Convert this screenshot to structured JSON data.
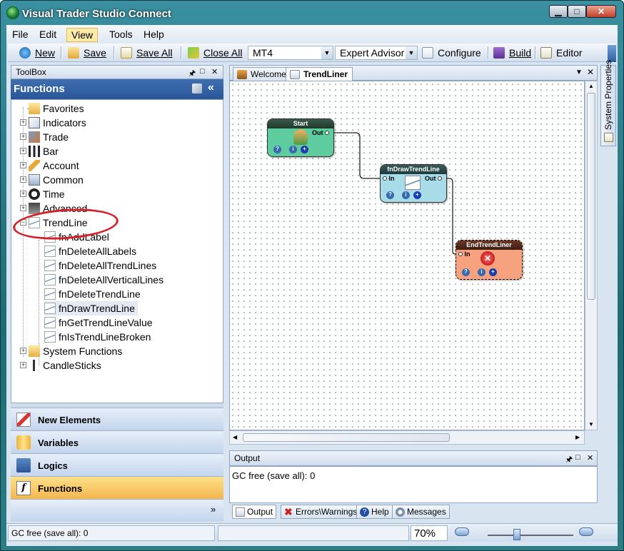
{
  "window": {
    "title": "Visual Trader Studio Connect"
  },
  "menu": [
    "File",
    "Edit",
    "View",
    "Tools",
    "Help"
  ],
  "toolbar": {
    "new_label": "New",
    "save_label": "Save",
    "save_all_label": "Save All",
    "close_all_label": "Close All",
    "platform_select": "MT4",
    "type_select": "Expert Advisor",
    "configure_label": "Configure",
    "build_label": "Build",
    "editor_label": "Editor"
  },
  "toolbox": {
    "header": "ToolBox",
    "section_title": "Functions",
    "tree": [
      {
        "label": "Favorites",
        "icon": "star-folder-icon"
      },
      {
        "label": "Indicators",
        "icon": "chart-icon"
      },
      {
        "label": "Trade",
        "icon": "trade-icon"
      },
      {
        "label": "Bar",
        "icon": "bar-chart-icon"
      },
      {
        "label": "Account",
        "icon": "pencil-icon"
      },
      {
        "label": "Common",
        "icon": "common-icon"
      },
      {
        "label": "Time",
        "icon": "clock-icon"
      },
      {
        "label": "Advanced",
        "icon": "advanced-icon"
      },
      {
        "label": "TrendLine",
        "icon": "trendline-icon"
      }
    ],
    "trendline_children": [
      "fnAddLabel",
      "fnDeleteAllLabels",
      "fnDeleteAllTrendLines",
      "fnDeleteAllVerticalLines",
      "fnDeleteTrendLine",
      "fnDrawTrendLine",
      "fnGetTrendLineValue",
      "fnIsTrendLineBroken"
    ],
    "tree_tail": [
      {
        "label": "System Functions",
        "icon": "folder-icon"
      },
      {
        "label": "CandleSticks",
        "icon": "candlestick-icon"
      }
    ],
    "groups": [
      "New Elements",
      "Variables",
      "Logics",
      "Functions"
    ]
  },
  "document_tabs": [
    "Welcome",
    "TrendLiner"
  ],
  "diagram": {
    "nodes": [
      {
        "title": "Start",
        "ports_in": "",
        "ports_out": "Out",
        "color": "#5fcca0"
      },
      {
        "title": "fnDrawTrendLine",
        "ports_in": "In",
        "ports_out": "Out",
        "color": "#a8dce8"
      },
      {
        "title": "EndTrendLiner",
        "ports_in": "In",
        "ports_out": "",
        "color": "#f7a27e"
      }
    ]
  },
  "output": {
    "header": "Output",
    "text": "GC free (save all): 0",
    "tabs": [
      "Output",
      "Errors\\Warnings",
      "Help",
      "Messages"
    ]
  },
  "side_panel": {
    "label": "System Properties"
  },
  "status": {
    "text": "GC free (save all): 0",
    "zoom": "70%"
  }
}
